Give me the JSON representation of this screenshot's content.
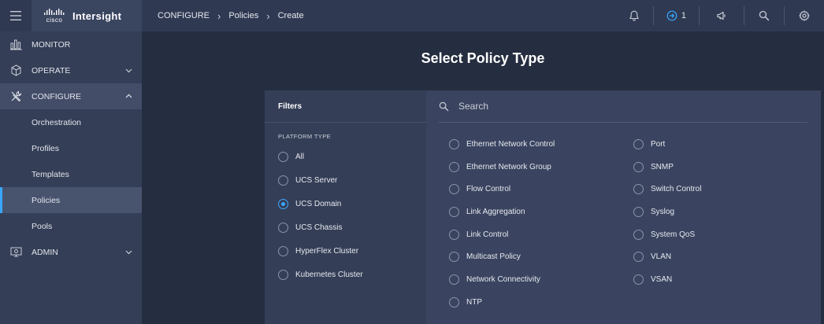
{
  "app": {
    "name": "Intersight",
    "logo_text": "cisco"
  },
  "breadcrumb": [
    "CONFIGURE",
    "Policies",
    "Create"
  ],
  "topbar": {
    "notification_count": "1"
  },
  "sidebar": {
    "monitor": "MONITOR",
    "operate": "OPERATE",
    "configure": "CONFIGURE",
    "configure_items": [
      "Orchestration",
      "Profiles",
      "Templates",
      "Policies",
      "Pools"
    ],
    "admin": "ADMIN"
  },
  "main": {
    "title": "Select Policy Type"
  },
  "filters": {
    "header": "Filters",
    "group_label": "PLATFORM TYPE",
    "options": [
      "All",
      "UCS Server",
      "UCS Domain",
      "UCS Chassis",
      "HyperFlex Cluster",
      "Kubernetes Cluster"
    ],
    "selected": "UCS Domain"
  },
  "search": {
    "placeholder": "Search"
  },
  "policies": {
    "left": [
      "Ethernet Network Control",
      "Ethernet Network Group",
      "Flow Control",
      "Link Aggregation",
      "Link Control",
      "Multicast Policy",
      "Network Connectivity",
      "NTP"
    ],
    "right": [
      "Port",
      "SNMP",
      "Switch Control",
      "Syslog",
      "System QoS",
      "VLAN",
      "VSAN"
    ]
  },
  "colors": {
    "accent": "#3aa7ff",
    "background": "#252d40",
    "topbar": "#2f3952",
    "sidebar": "#343e56"
  }
}
